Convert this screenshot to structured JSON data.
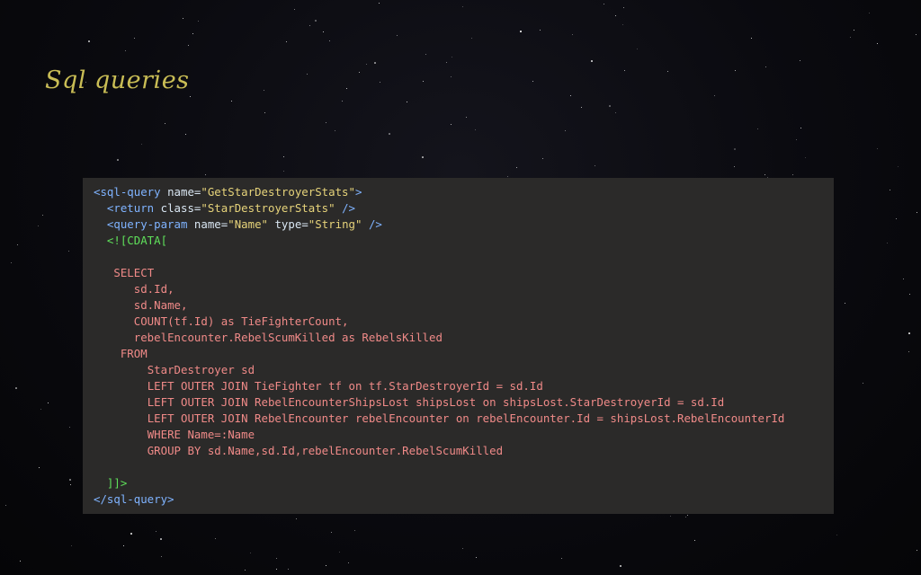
{
  "slide": {
    "title": "Sql queries"
  },
  "code": {
    "open_tag_bracket": "<",
    "open_tag_name": "sql-query",
    "open_attr_name": "name",
    "open_attr_value": "\"GetStarDestroyerStats\"",
    "open_tag_end": ">",
    "return_tag": "<return",
    "return_attr": "class",
    "return_value": "\"StarDestroyerStats\"",
    "return_end": "/>",
    "param_tag": "<query-param",
    "param_attr1": "name",
    "param_value1": "\"Name\"",
    "param_attr2": "type",
    "param_value2": "\"String\"",
    "param_end": "/>",
    "cdata_open": "<![CDATA[",
    "sql_lines": [
      "SELECT",
      "sd.Id,",
      "sd.Name,",
      "COUNT(tf.Id) as TieFighterCount,",
      "rebelEncounter.RebelScumKilled as RebelsKilled",
      "FROM",
      "StarDestroyer sd",
      "LEFT OUTER JOIN TieFighter tf on tf.StarDestroyerId = sd.Id",
      "LEFT OUTER JOIN RebelEncounterShipsLost shipsLost on shipsLost.StarDestroyerId = sd.Id",
      "LEFT OUTER JOIN RebelEncounter rebelEncounter on rebelEncounter.Id = shipsLost.RebelEncounterId",
      "WHERE Name=:Name",
      "GROUP BY sd.Name,sd.Id,rebelEncounter.RebelScumKilled"
    ],
    "cdata_close": "]]>",
    "close_tag": "</sql-query>"
  }
}
